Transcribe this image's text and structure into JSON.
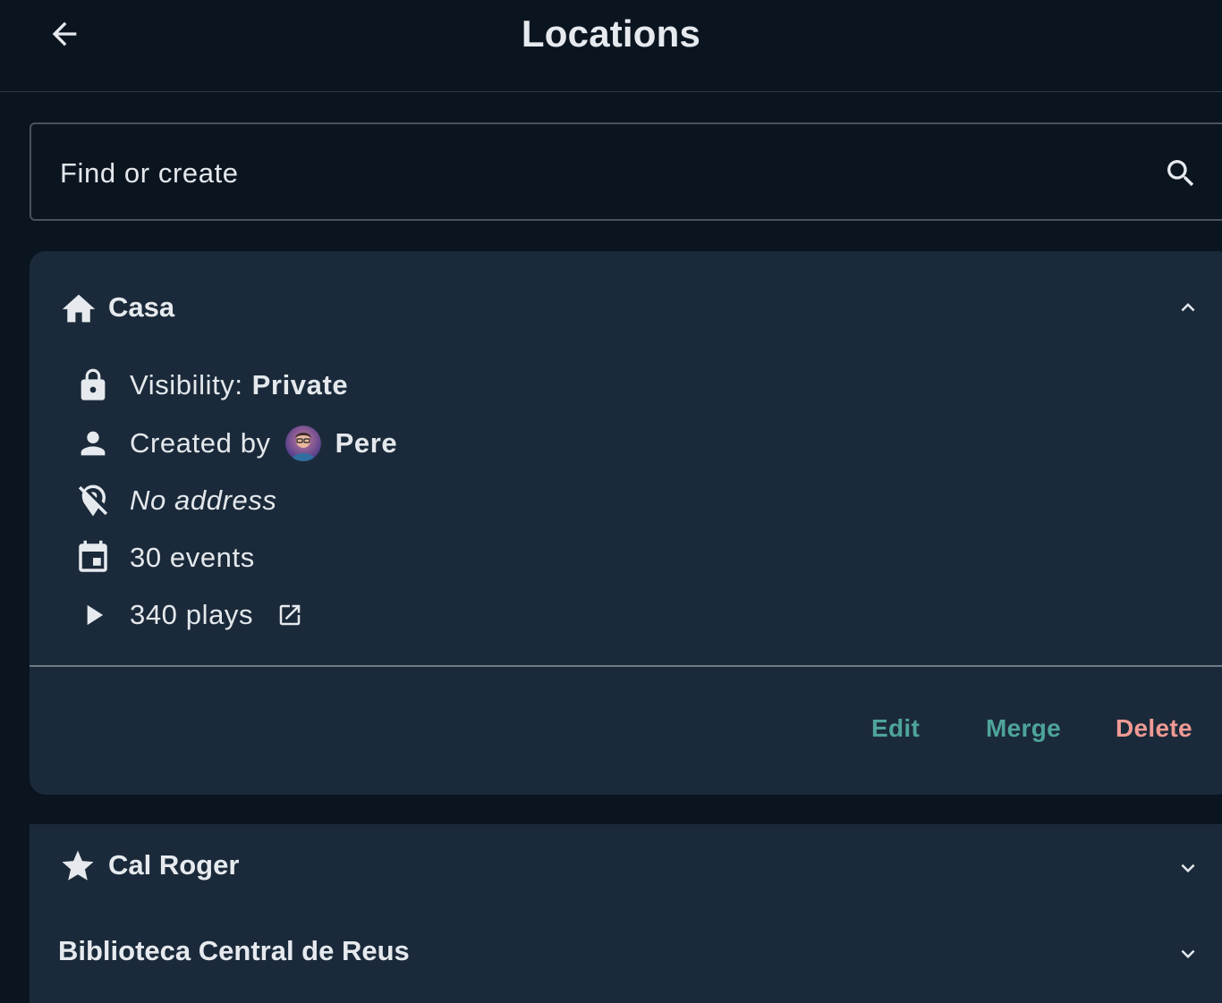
{
  "header": {
    "title": "Locations",
    "back_icon": "arrow-left-icon"
  },
  "search": {
    "placeholder": "Find or create",
    "value": "",
    "icon": "search-icon"
  },
  "expanded_location": {
    "icon": "home-icon",
    "name": "Casa",
    "expanded": true,
    "visibility_label": "Visibility:",
    "visibility_value": "Private",
    "created_by_label": "Created by",
    "created_by_name": "Pere",
    "address": "No address",
    "events": "30 events",
    "plays": "340 plays",
    "actions": {
      "edit": "Edit",
      "merge": "Merge",
      "delete": "Delete"
    }
  },
  "collapsed_locations": [
    {
      "icon": "star-icon",
      "name": "Cal Roger"
    },
    {
      "icon": "",
      "name": "Biblioteca Central de Reus"
    }
  ],
  "colors": {
    "background": "#0b1520",
    "card": "#1b2a3a",
    "accent": "#4ea49a",
    "danger": "#f09a94",
    "text": "#e4e8ec"
  }
}
